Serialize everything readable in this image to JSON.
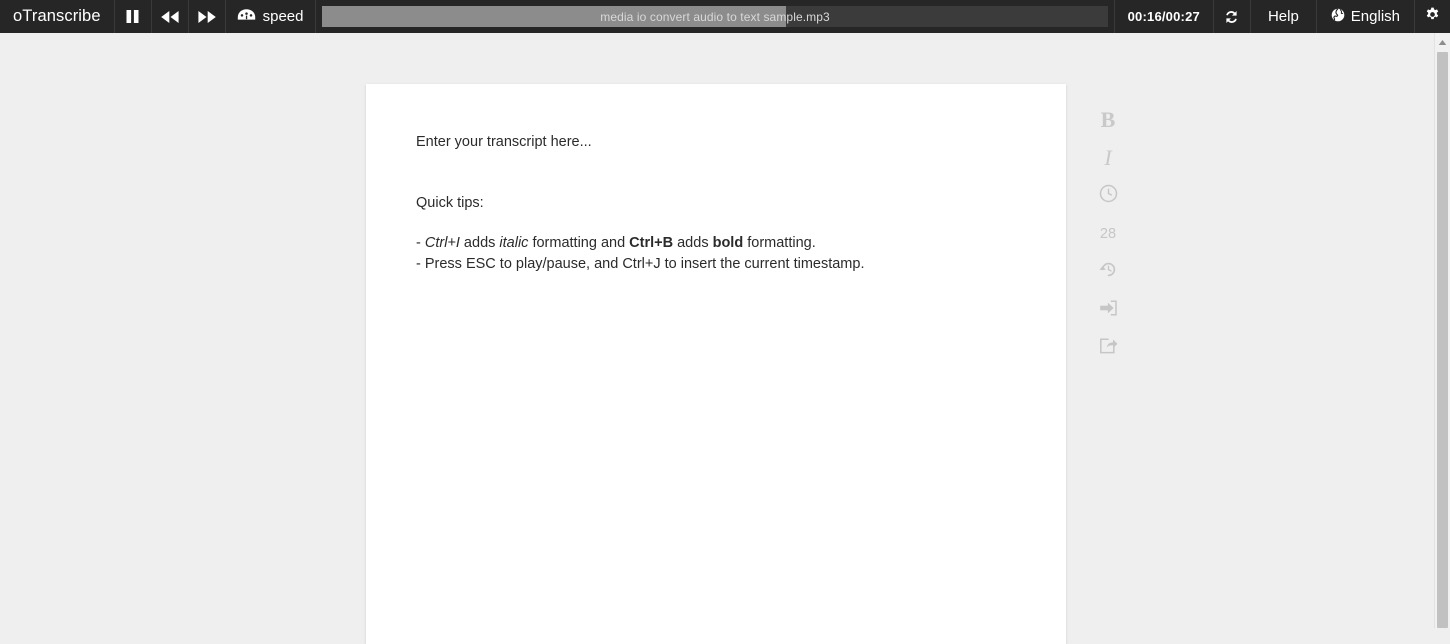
{
  "toolbar": {
    "brand": "oTranscribe",
    "controls": [
      {
        "name": "pause-button",
        "icon": "pause-icon",
        "label": ""
      },
      {
        "name": "rewind-button",
        "icon": "rewind-icon",
        "label": ""
      },
      {
        "name": "fast-forward-button",
        "icon": "fast-forward-icon",
        "label": ""
      }
    ],
    "speed_label": "speed",
    "speed_icon": "speedometer-icon",
    "media_filename": "media io convert audio to text sample.mp3",
    "progress_percent": 59,
    "time_display": "00:16/00:27",
    "current_time": "00:16",
    "total_time": "00:27",
    "sync_icon": "sync-icon",
    "help_label": "Help",
    "language_label": "English",
    "language_icon": "globe-icon",
    "settings_icon": "gear-icon"
  },
  "editor": {
    "placeholder_line": "Enter your transcript here...",
    "tips_heading": "Quick tips:",
    "tip_1": {
      "prefix": "- ",
      "shortcut_italic": "Ctrl+I",
      "mid_1": " adds ",
      "word_italic": "italic",
      "mid_2": " formatting and ",
      "shortcut_bold": "Ctrl+B",
      "mid_3": " adds ",
      "word_bold": "bold",
      "suffix": " formatting."
    },
    "tip_2": "- Press ESC to play/pause, and Ctrl+J to insert the current timestamp."
  },
  "rail": {
    "bold_label": "B",
    "italic_label": "I",
    "timestamp_icon": "clock-icon",
    "word_count": "28",
    "restore_icon": "restore-history-icon",
    "import_icon": "import-icon",
    "export_icon": "export-share-icon"
  },
  "scrollbar": {
    "up_arrow_icon": "scroll-up-arrow-icon"
  },
  "colors": {
    "toolbar_bg": "#262626",
    "body_bg": "#efefef",
    "page_bg": "#ffffff",
    "progress_fill": "#8c8c8c",
    "progress_track": "#3b3b3b",
    "rail_icon": "#c6c6c6"
  }
}
